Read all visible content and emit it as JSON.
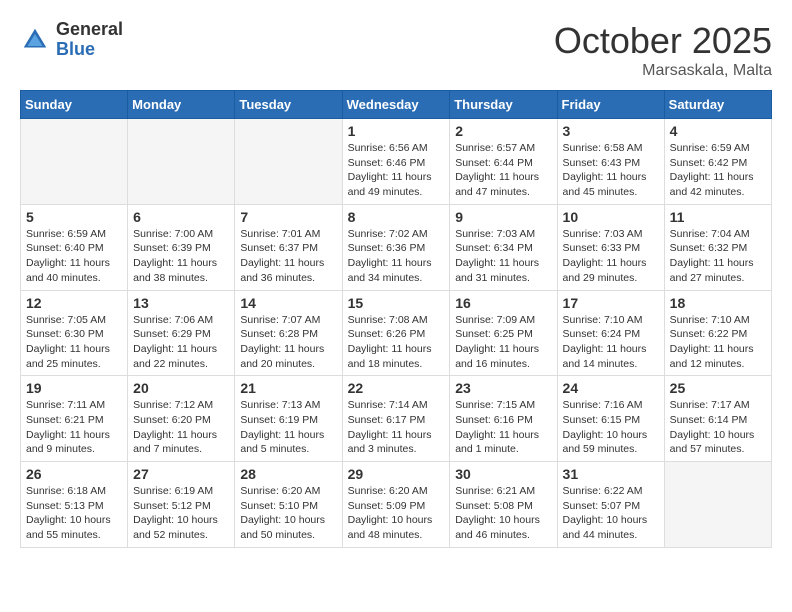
{
  "logo": {
    "general": "General",
    "blue": "Blue"
  },
  "title": "October 2025",
  "location": "Marsaskala, Malta",
  "days_header": [
    "Sunday",
    "Monday",
    "Tuesday",
    "Wednesday",
    "Thursday",
    "Friday",
    "Saturday"
  ],
  "weeks": [
    [
      {
        "day": "",
        "info": ""
      },
      {
        "day": "",
        "info": ""
      },
      {
        "day": "",
        "info": ""
      },
      {
        "day": "1",
        "info": "Sunrise: 6:56 AM\nSunset: 6:46 PM\nDaylight: 11 hours\nand 49 minutes."
      },
      {
        "day": "2",
        "info": "Sunrise: 6:57 AM\nSunset: 6:44 PM\nDaylight: 11 hours\nand 47 minutes."
      },
      {
        "day": "3",
        "info": "Sunrise: 6:58 AM\nSunset: 6:43 PM\nDaylight: 11 hours\nand 45 minutes."
      },
      {
        "day": "4",
        "info": "Sunrise: 6:59 AM\nSunset: 6:42 PM\nDaylight: 11 hours\nand 42 minutes."
      }
    ],
    [
      {
        "day": "5",
        "info": "Sunrise: 6:59 AM\nSunset: 6:40 PM\nDaylight: 11 hours\nand 40 minutes."
      },
      {
        "day": "6",
        "info": "Sunrise: 7:00 AM\nSunset: 6:39 PM\nDaylight: 11 hours\nand 38 minutes."
      },
      {
        "day": "7",
        "info": "Sunrise: 7:01 AM\nSunset: 6:37 PM\nDaylight: 11 hours\nand 36 minutes."
      },
      {
        "day": "8",
        "info": "Sunrise: 7:02 AM\nSunset: 6:36 PM\nDaylight: 11 hours\nand 34 minutes."
      },
      {
        "day": "9",
        "info": "Sunrise: 7:03 AM\nSunset: 6:34 PM\nDaylight: 11 hours\nand 31 minutes."
      },
      {
        "day": "10",
        "info": "Sunrise: 7:03 AM\nSunset: 6:33 PM\nDaylight: 11 hours\nand 29 minutes."
      },
      {
        "day": "11",
        "info": "Sunrise: 7:04 AM\nSunset: 6:32 PM\nDaylight: 11 hours\nand 27 minutes."
      }
    ],
    [
      {
        "day": "12",
        "info": "Sunrise: 7:05 AM\nSunset: 6:30 PM\nDaylight: 11 hours\nand 25 minutes."
      },
      {
        "day": "13",
        "info": "Sunrise: 7:06 AM\nSunset: 6:29 PM\nDaylight: 11 hours\nand 22 minutes."
      },
      {
        "day": "14",
        "info": "Sunrise: 7:07 AM\nSunset: 6:28 PM\nDaylight: 11 hours\nand 20 minutes."
      },
      {
        "day": "15",
        "info": "Sunrise: 7:08 AM\nSunset: 6:26 PM\nDaylight: 11 hours\nand 18 minutes."
      },
      {
        "day": "16",
        "info": "Sunrise: 7:09 AM\nSunset: 6:25 PM\nDaylight: 11 hours\nand 16 minutes."
      },
      {
        "day": "17",
        "info": "Sunrise: 7:10 AM\nSunset: 6:24 PM\nDaylight: 11 hours\nand 14 minutes."
      },
      {
        "day": "18",
        "info": "Sunrise: 7:10 AM\nSunset: 6:22 PM\nDaylight: 11 hours\nand 12 minutes."
      }
    ],
    [
      {
        "day": "19",
        "info": "Sunrise: 7:11 AM\nSunset: 6:21 PM\nDaylight: 11 hours\nand 9 minutes."
      },
      {
        "day": "20",
        "info": "Sunrise: 7:12 AM\nSunset: 6:20 PM\nDaylight: 11 hours\nand 7 minutes."
      },
      {
        "day": "21",
        "info": "Sunrise: 7:13 AM\nSunset: 6:19 PM\nDaylight: 11 hours\nand 5 minutes."
      },
      {
        "day": "22",
        "info": "Sunrise: 7:14 AM\nSunset: 6:17 PM\nDaylight: 11 hours\nand 3 minutes."
      },
      {
        "day": "23",
        "info": "Sunrise: 7:15 AM\nSunset: 6:16 PM\nDaylight: 11 hours\nand 1 minute."
      },
      {
        "day": "24",
        "info": "Sunrise: 7:16 AM\nSunset: 6:15 PM\nDaylight: 10 hours\nand 59 minutes."
      },
      {
        "day": "25",
        "info": "Sunrise: 7:17 AM\nSunset: 6:14 PM\nDaylight: 10 hours\nand 57 minutes."
      }
    ],
    [
      {
        "day": "26",
        "info": "Sunrise: 6:18 AM\nSunset: 5:13 PM\nDaylight: 10 hours\nand 55 minutes."
      },
      {
        "day": "27",
        "info": "Sunrise: 6:19 AM\nSunset: 5:12 PM\nDaylight: 10 hours\nand 52 minutes."
      },
      {
        "day": "28",
        "info": "Sunrise: 6:20 AM\nSunset: 5:10 PM\nDaylight: 10 hours\nand 50 minutes."
      },
      {
        "day": "29",
        "info": "Sunrise: 6:20 AM\nSunset: 5:09 PM\nDaylight: 10 hours\nand 48 minutes."
      },
      {
        "day": "30",
        "info": "Sunrise: 6:21 AM\nSunset: 5:08 PM\nDaylight: 10 hours\nand 46 minutes."
      },
      {
        "day": "31",
        "info": "Sunrise: 6:22 AM\nSunset: 5:07 PM\nDaylight: 10 hours\nand 44 minutes."
      },
      {
        "day": "",
        "info": ""
      }
    ]
  ]
}
